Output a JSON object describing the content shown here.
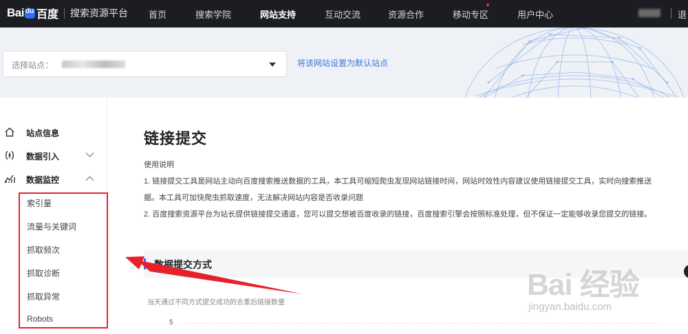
{
  "header": {
    "logo_baidu": "Bai",
    "logo_baidu_cn": "百度",
    "platform_name": "搜索资源平台",
    "nav_items": [
      {
        "label": "首页",
        "active": false
      },
      {
        "label": "搜索学院",
        "active": false
      },
      {
        "label": "网站支持",
        "active": true
      },
      {
        "label": "互动交流",
        "active": false
      },
      {
        "label": "资源合作",
        "active": false
      },
      {
        "label": "移动专区",
        "active": false,
        "badge": true
      },
      {
        "label": "用户中心",
        "active": false
      }
    ],
    "exit_label": "退"
  },
  "banner": {
    "site_select_label": "选择站点：",
    "set_default_link": "将该网站设置为默认站点"
  },
  "sidebar": {
    "items": [
      {
        "label": "站点信息",
        "icon": "home-icon",
        "expandable": false
      },
      {
        "label": "数据引入",
        "icon": "data-import-icon",
        "expandable": true,
        "expanded": false
      },
      {
        "label": "数据监控",
        "icon": "chart-monitor-icon",
        "expandable": true,
        "expanded": true
      }
    ],
    "sub_items": [
      "索引量",
      "流量与关键词",
      "抓取频次",
      "抓取诊断",
      "抓取异常",
      "Robots"
    ]
  },
  "main": {
    "title": "链接提交",
    "usage_title": "使用说明",
    "usage_lines": [
      "1. 链接提交工具是网站主动向百度搜索推送数据的工具，本工具可缩短爬虫发现网站链接时间，网站时效性内容建议使用链接提交工具，实时向搜索推送",
      "据。本工具可加快爬虫抓取速度，无法解决网站内容是否收录问题",
      "2. 百度搜索资源平台为站长提供链接提交通道，您可以提交想被百度收录的链接，百度搜索引擎会按照标准处理，但不保证一定能够收录您提交的链接。"
    ],
    "section_title": "数据提交方式",
    "chart_caption": "当天通过不同方式提交成功的去重后链接数量",
    "chart_ytick": "5"
  },
  "watermark": {
    "text": "Bai 经验",
    "url": "jingyan.baidu.com"
  },
  "colors": {
    "topbar_bg": "#1b1d22",
    "link_blue": "#3a77e5",
    "accent_blue": "#2f6bff",
    "highlight_red": "#e8202a"
  }
}
